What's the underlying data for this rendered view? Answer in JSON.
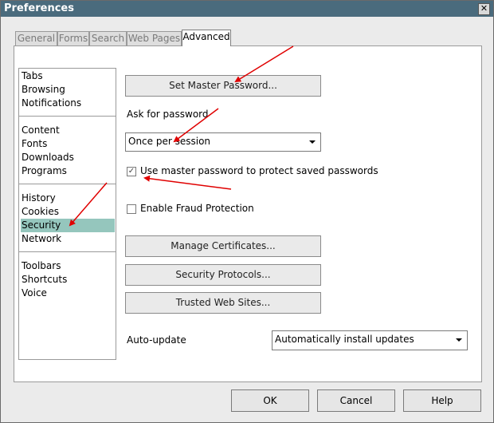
{
  "window": {
    "title": "Preferences",
    "close_glyph": "✕"
  },
  "tabs": [
    {
      "label": "General"
    },
    {
      "label": "Forms"
    },
    {
      "label": "Search"
    },
    {
      "label": "Web Pages"
    },
    {
      "label": "Advanced"
    }
  ],
  "sidebar": {
    "items": [
      {
        "label": "Tabs"
      },
      {
        "label": "Browsing"
      },
      {
        "label": "Notifications"
      },
      {
        "label": "Content"
      },
      {
        "label": "Fonts"
      },
      {
        "label": "Downloads"
      },
      {
        "label": "Programs"
      },
      {
        "label": "History"
      },
      {
        "label": "Cookies"
      },
      {
        "label": "Security"
      },
      {
        "label": "Network"
      },
      {
        "label": "Toolbars"
      },
      {
        "label": "Shortcuts"
      },
      {
        "label": "Voice"
      }
    ],
    "selected": "Security"
  },
  "security": {
    "set_master_password": "Set Master Password...",
    "ask_for_password_label": "Ask for password",
    "ask_for_password_value": "Once per session",
    "use_master_password_label": "Use master password to protect saved passwords",
    "use_master_password_checked": true,
    "enable_fraud_protection_label": "Enable Fraud Protection",
    "enable_fraud_protection_checked": false,
    "manage_certificates": "Manage Certificates...",
    "security_protocols": "Security Protocols...",
    "trusted_web_sites": "Trusted Web Sites...",
    "auto_update_label": "Auto-update",
    "auto_update_value": "Automatically install updates",
    "check_glyph": "✓"
  },
  "footer": {
    "ok": "OK",
    "cancel": "Cancel",
    "help": "Help"
  },
  "colors": {
    "titlebar": "#4a6b7d",
    "selection": "#95c6bd",
    "annotation_arrow": "#e00000"
  }
}
